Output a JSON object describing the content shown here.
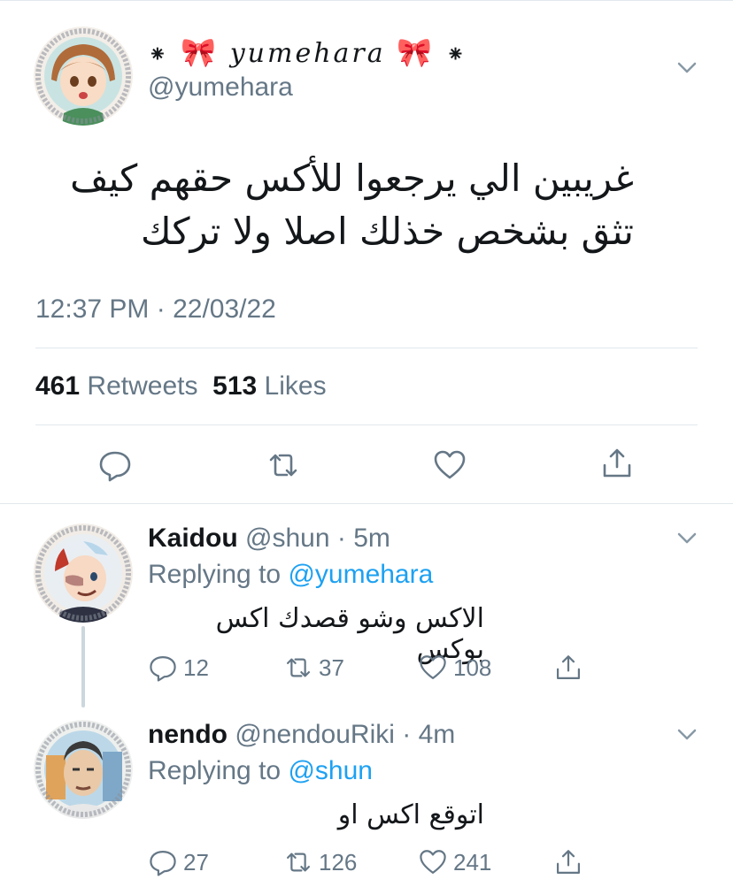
{
  "main_tweet": {
    "display_name": "yumehara",
    "name_decor_left": "⁕",
    "name_decor_right": "⁕",
    "bow": "🎀",
    "handle": "@yumehara",
    "text": "غريبين الي يرجعوا للأكس حقهم كيف تثق بشخص خذلك اصلا ولا تركك",
    "timestamp": "12:37 PM · 22/03/22",
    "retweets_count": "461",
    "retweets_label": "Retweets",
    "likes_count": "513",
    "likes_label": "Likes",
    "avatar_watermark": "@animeFakeTweets"
  },
  "replies": [
    {
      "display_name": "Kaidou",
      "handle": "@shun",
      "time": "5m",
      "replying_prefix": "Replying to",
      "replying_to": "@yumehara",
      "text": "الاكس وشو قصدك اكس بوكس",
      "reply_count": "12",
      "retweet_count": "37",
      "like_count": "108",
      "avatar_watermark": "@animeFakeTweets"
    },
    {
      "display_name": "nendo",
      "handle": "@nendouRiki",
      "time": "4m",
      "replying_prefix": "Replying to",
      "replying_to": "@shun",
      "text": "اتوقع اكس او",
      "reply_count": "27",
      "retweet_count": "126",
      "like_count": "241",
      "avatar_watermark": "@animeFakeTweets"
    }
  ],
  "colors": {
    "text": "#14171a",
    "secondary": "#657786",
    "link": "#1da1f2",
    "divider": "#e1e8ed"
  }
}
